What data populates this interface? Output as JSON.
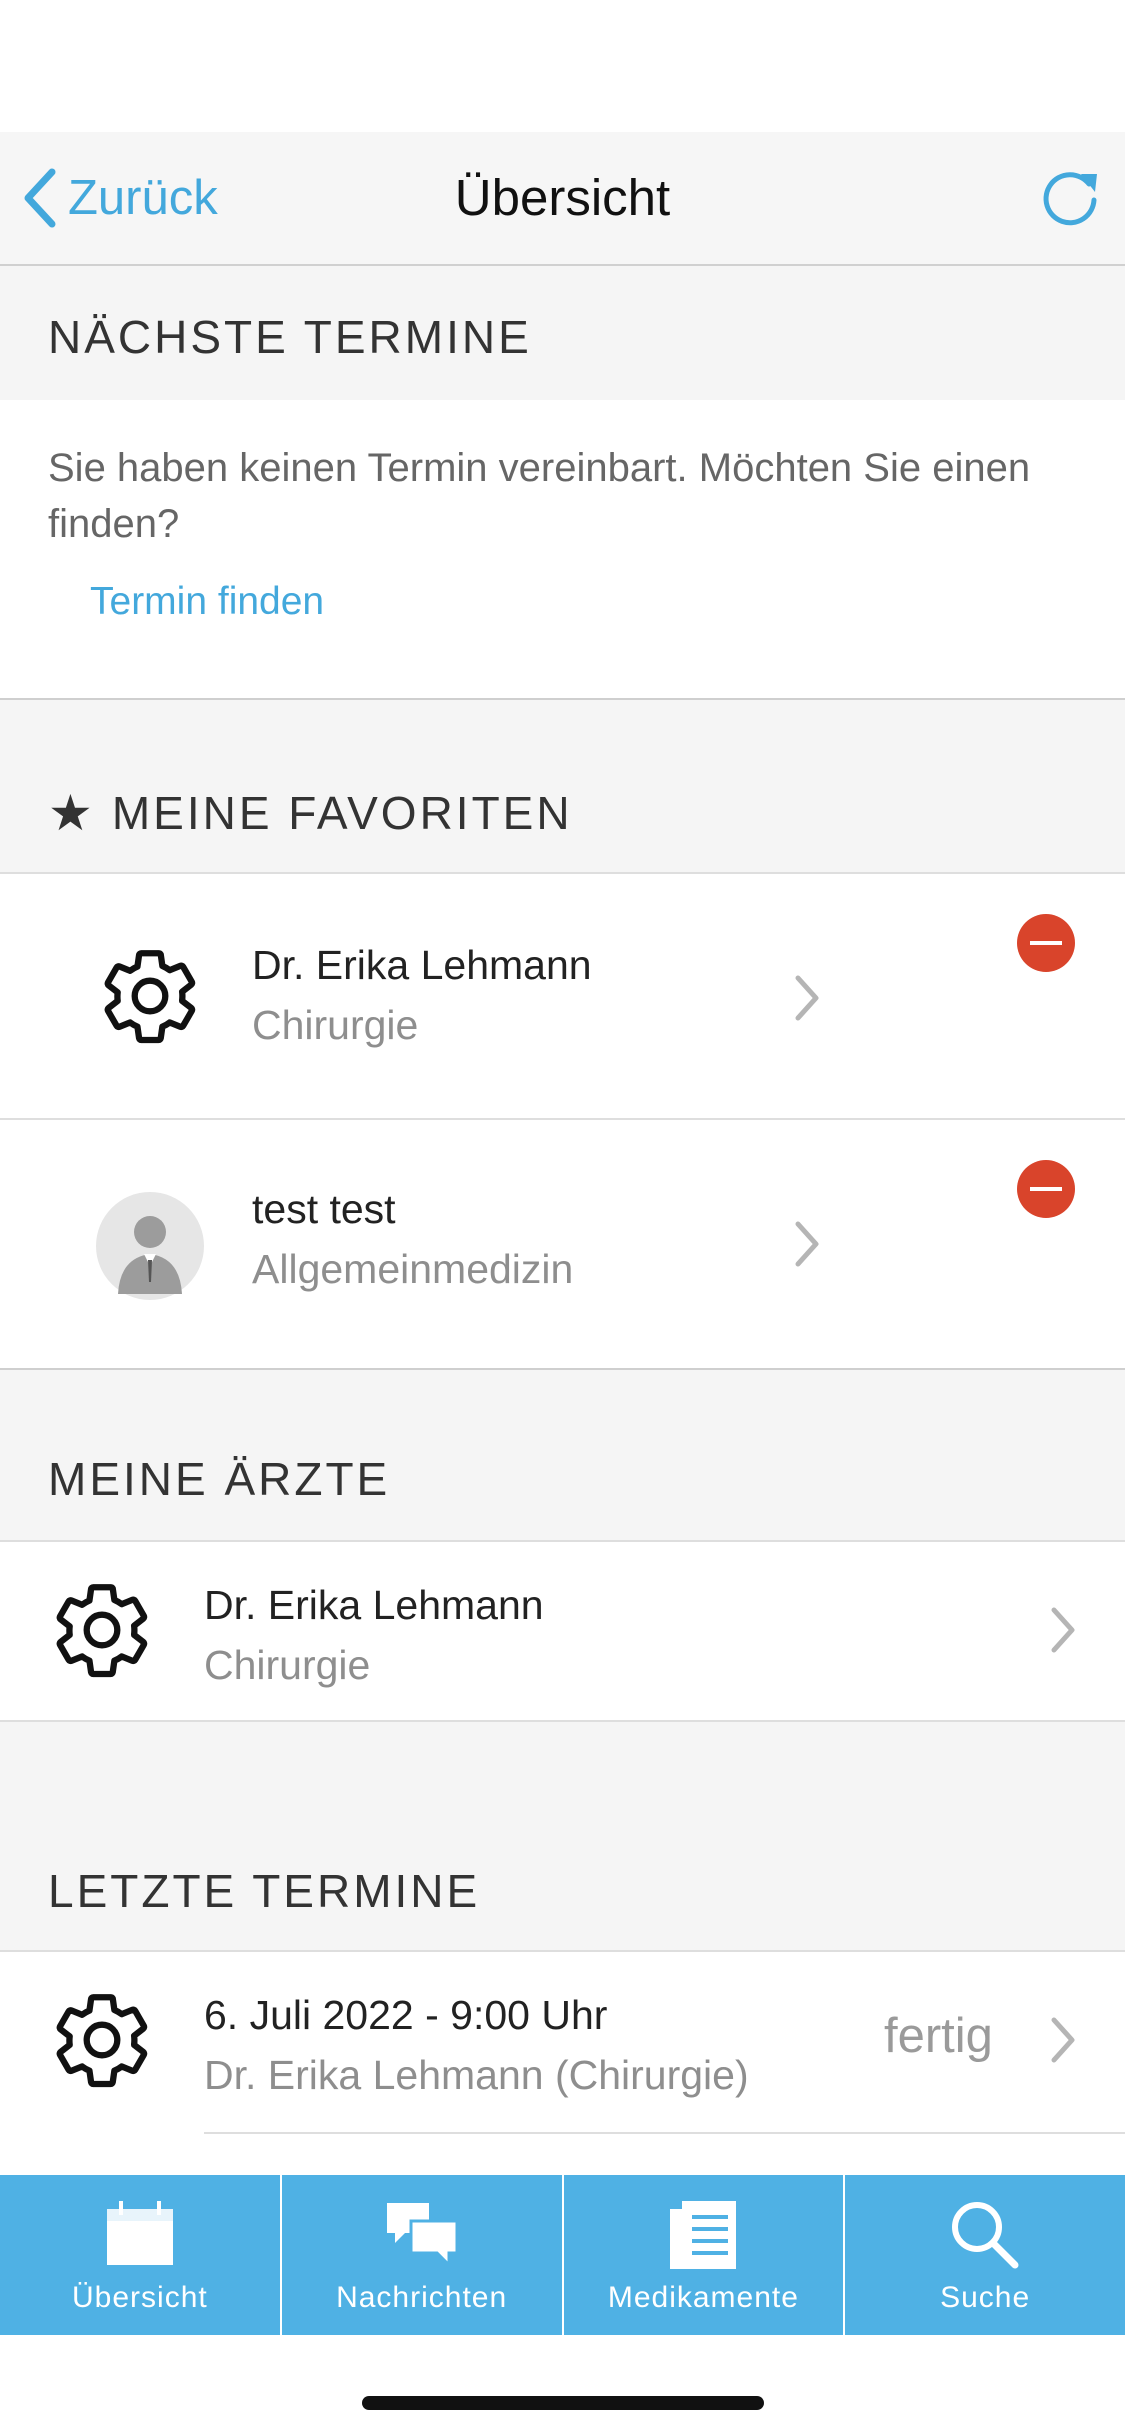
{
  "nav": {
    "back_label": "Zurück",
    "title": "Übersicht",
    "refresh_icon": "refresh-icon"
  },
  "next_appointments": {
    "header": "NÄCHSTE TERMINE",
    "message": "Sie haben keinen Termin vereinbart. Möchten Sie einen finden?",
    "link": "Termin finden"
  },
  "favorites": {
    "header": "MEINE FAVORITEN",
    "items": [
      {
        "name": "Dr. Erika Lehmann",
        "specialty": "Chirurgie",
        "icon": "gear-icon"
      },
      {
        "name": "test test",
        "specialty": "Allgemeinmedizin",
        "icon": "avatar"
      }
    ]
  },
  "doctors": {
    "header": "MEINE ÄRZTE",
    "items": [
      {
        "name": "Dr. Erika Lehmann",
        "specialty": "Chirurgie",
        "icon": "gear-icon"
      }
    ]
  },
  "last_appointments": {
    "header": "LETZTE TERMINE",
    "items": [
      {
        "date": "6. Juli 2022 - 9:00 Uhr",
        "doctor": "Dr. Erika Lehmann (Chirurgie)",
        "status": "fertig",
        "icon": "gear-icon"
      }
    ]
  },
  "tabs": [
    {
      "label": "Übersicht",
      "icon": "calendar-icon"
    },
    {
      "label": "Nachrichten",
      "icon": "chat-bubbles-icon"
    },
    {
      "label": "Medikamente",
      "icon": "document-list-icon"
    },
    {
      "label": "Suche",
      "icon": "search-icon"
    }
  ],
  "colors": {
    "accent": "#43a8dc",
    "tabbar": "#4fb1e4",
    "remove": "#d9442b"
  }
}
